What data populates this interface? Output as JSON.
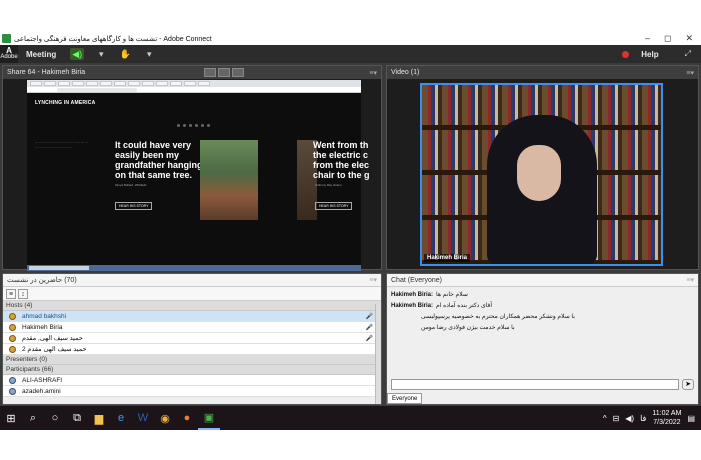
{
  "window": {
    "title": "تشست ها و کارگاههای معاونت فرهنگی واجتماعی - Adobe Connect",
    "controls": [
      "–",
      "◻",
      "✕"
    ]
  },
  "menubar": {
    "logo_top": "A",
    "logo_bottom": "Adobe",
    "meeting": "Meeting",
    "help": "Help"
  },
  "share": {
    "title": "Share 64 - Hakimeh Biria",
    "page_heading": "LYNCHING IN AMERICA",
    "quote1": "It could have very easily been my grandfather hanging on that same tree.",
    "quote1_author": "Tanya Bullard, Whitfield",
    "quote2": "Went from th the electric c from the elec chair to the g",
    "quote2_author": "Anthony Ray Hinton",
    "button": "HEAR HIS STORY"
  },
  "video": {
    "title": "Video",
    "count": "(1)",
    "name": "Hakimeh Biria"
  },
  "attendees": {
    "title": "حاضرین در نشست",
    "count": "(70)",
    "hosts_label": "Hosts (4)",
    "hosts": [
      "ahmad bakhshi",
      "Hakimeh Biria",
      "حمید سیف الهی, مقدم",
      "حمید سیف الهی مقدم 2"
    ],
    "presenters_label": "Presenters (0)",
    "participants_label": "Participants (66)",
    "participants": [
      "ALI-ASHRAFI",
      "azadeh.amini"
    ]
  },
  "chat": {
    "title": "Chat",
    "scope": "(Everyone)",
    "messages": [
      {
        "name": "Hakimeh Biria:",
        "text": "سلام خانم ها"
      },
      {
        "name": "Hakimeh Biria:",
        "text": "آقای دکتر بنده آماده ام"
      },
      {
        "name": "",
        "text": "با سلام وتشکر محضر همکاران محترم به خصوصیه پرسپولیسی"
      },
      {
        "name": "",
        "text": "با سلام خدمت بیژن فولادی رضا مومن"
      }
    ],
    "target": "Everyone"
  },
  "taskbar": {
    "time": "11:02 AM",
    "date": "7/3/2022",
    "lang": "فا"
  }
}
